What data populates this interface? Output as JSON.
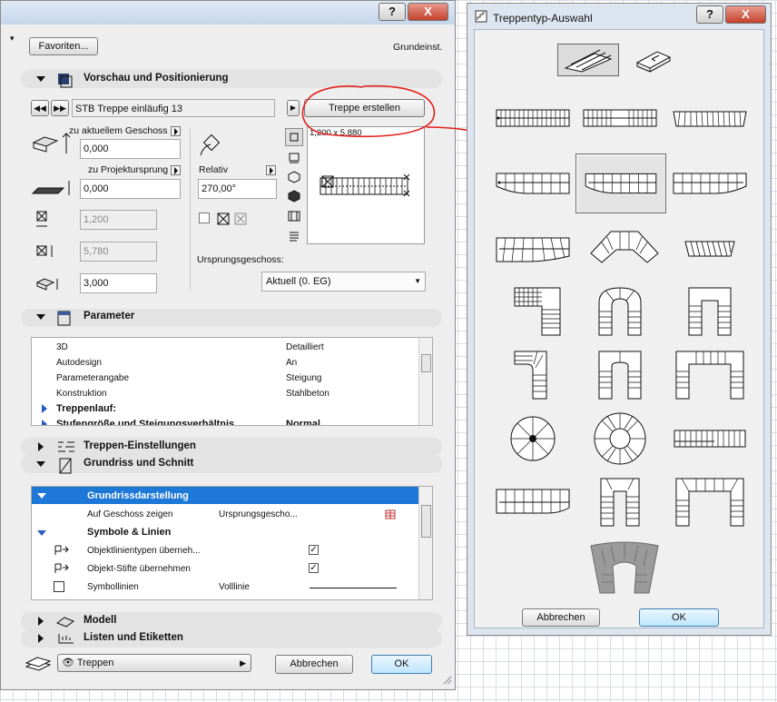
{
  "main": {
    "favorites_label": "Favoriten...",
    "preset_label": "Grundeinst.",
    "section_preview": "Vorschau und Positionierung",
    "stair_name": "STB Treppe einläufig 13",
    "create_stair_label": "Treppe erstellen",
    "label_to_current_floor": "zu aktuellem Geschoss",
    "value_elev1": "0,000",
    "label_to_project_zero": "zu Projektursprung",
    "value_elev2": "0,000",
    "label_relative": "Relativ",
    "value_angle": "270,00°",
    "value_width": "1,200",
    "value_length": "5,780",
    "value_height": "3,000",
    "preview_dimensions": "1,200 x 5,880",
    "label_origin_floor": "Ursprungsgeschoss:",
    "origin_floor_value": "Aktuell (0. EG)",
    "section_parameters": "Parameter",
    "param_rows": [
      {
        "name": "3D",
        "value": "Detailliert"
      },
      {
        "name": "Autodesign",
        "value": "An"
      },
      {
        "name": "Parameterangabe",
        "value": "Steigung"
      },
      {
        "name": "Konstruktion",
        "value": "Stahlbeton"
      }
    ],
    "param_group1": "Treppenlauf:",
    "param_group2": "Stufengröße und Steigungsverhältnis",
    "param_group2_value": "Normal",
    "section_settings": "Treppen-Einstellungen",
    "section_floorplan": "Grundriss und Schnitt",
    "fp_header": "Grundrissdarstellung",
    "fp_show_on_floor": "Auf Geschoss zeigen",
    "fp_show_on_floor_value": "Ursprungsgescho...",
    "fp_symbols_header": "Symbole & Linien",
    "fp_linetypes": "Objektlinientypen überneh...",
    "fp_pens": "Objekt-Stifte übernehmen",
    "fp_symbollines": "Symbollinien",
    "fp_symbollines_value": "Volllinie",
    "section_model": "Modell",
    "section_labels": "Listen und Etiketten",
    "layer_value": "Treppen",
    "cancel_label": "Abbrechen",
    "ok_label": "OK",
    "help_label": "?",
    "close_label": "X"
  },
  "stair_dialog": {
    "title": "Treppentyp-Auswahl",
    "cancel_label": "Abbrechen",
    "ok_label": "OK",
    "help_label": "?",
    "close_label": "X"
  },
  "colors": {
    "accent_blue": "#1e78d7",
    "annotation_red": "#e0211b"
  }
}
